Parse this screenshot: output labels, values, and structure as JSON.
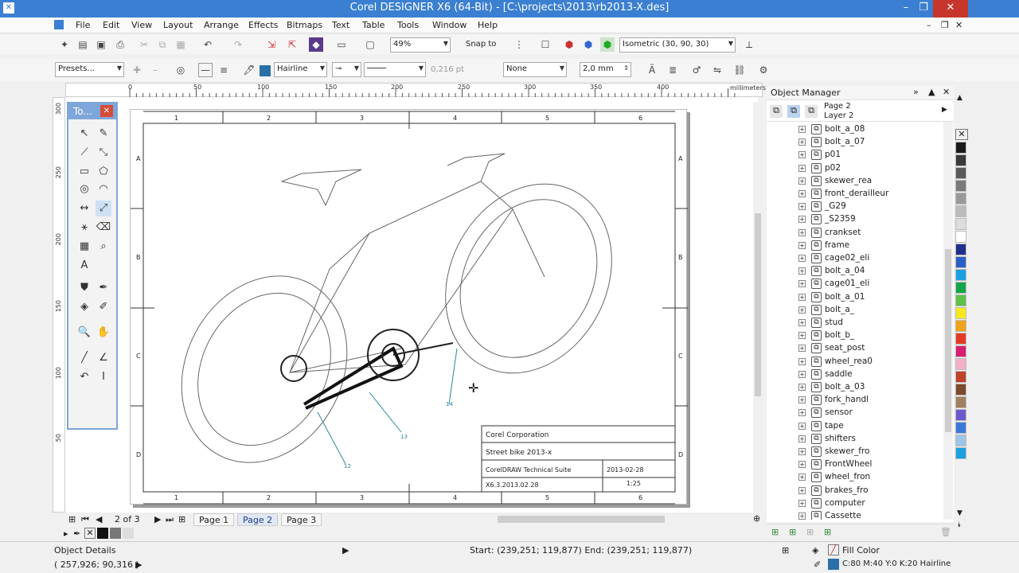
{
  "window": {
    "title": "Corel DESIGNER X6 (64-Bit) - [C:\\projects\\2013\\rb2013-X.des]"
  },
  "menu": [
    "File",
    "Edit",
    "View",
    "Layout",
    "Arrange",
    "Effects",
    "Bitmaps",
    "Text",
    "Table",
    "Tools",
    "Window",
    "Help"
  ],
  "standard_toolbar": {
    "zoom": "49%",
    "snap_to": "Snap to",
    "projection": "Isometric (30, 90, 30)"
  },
  "property_bar": {
    "presets": "Presets...",
    "outline_color_label": "Hairline",
    "offset": "0,216 pt",
    "arrow_end": "None",
    "size": "2,0 mm"
  },
  "ruler": {
    "units": "millimeters",
    "h_ticks": [
      "0",
      "50",
      "100",
      "150",
      "200",
      "250",
      "300",
      "350",
      "400"
    ],
    "v_ticks": [
      "300",
      "250",
      "200",
      "150",
      "100",
      "50"
    ]
  },
  "toolbox": {
    "title": "To..."
  },
  "drawing": {
    "col_labels": [
      "1",
      "2",
      "3",
      "4",
      "5",
      "6"
    ],
    "row_labels": [
      "A",
      "B",
      "C",
      "D"
    ],
    "callouts": [
      "14",
      "13",
      "12"
    ],
    "title_block": {
      "company": "Corel Corporation",
      "title": "Street bike 2013-x",
      "suite": "CorelDRAW Technical Suite",
      "date": "2013-02-28",
      "doc": "X6.3.2013.02.28",
      "scale": "1:25"
    }
  },
  "object_manager": {
    "title": "Object Manager",
    "page": "Page 2",
    "layer": "Layer 2",
    "items": [
      "bolt_a_08",
      "bolt_a_07",
      "p01",
      "p02",
      "skewer_rea",
      "front_derailleur",
      "_G29",
      "_S2359",
      "crankset",
      "frame",
      "cage02_eli",
      "bolt_a_04",
      "cage01_eli",
      "bolt_a_01",
      "bolt_a_",
      "stud",
      "bolt_b_",
      "seat_post",
      "wheel_rea0",
      "saddle",
      "bolt_a_03",
      "fork_handl",
      "sensor",
      "tape",
      "shifters",
      "skewer_fro",
      "FrontWheel",
      "wheel_fron",
      "brakes_fro",
      "computer",
      "Cassette"
    ]
  },
  "page_nav": {
    "counter": "2 of 3",
    "tabs": [
      "Page 1",
      "Page 2",
      "Page 3"
    ],
    "active": "Page 2"
  },
  "status": {
    "object_details": "Object Details",
    "coords": "( 257,926; 90,316 )",
    "start_end": "Start: (239,251; 119,877)  End: (239,251; 119,877)",
    "fill": "Fill Color",
    "outline": "C:80 M:40 Y:0 K:20  Hairline"
  },
  "colors": {
    "titlebar": "#3a7fd1",
    "accent": "#7ea6d8"
  },
  "palette": [
    "#1a1a1a",
    "#3a3a3a",
    "#5a5a5a",
    "#7a7a7a",
    "#9a9a9a",
    "#bcbcbc",
    "#dcdcdc",
    "#ffffff",
    "#1e2f8c",
    "#2960c7",
    "#1aa0e0",
    "#14a54b",
    "#5cc24a",
    "#f7e81c",
    "#f0a21a",
    "#e53a24",
    "#d81f6f",
    "#f4b0c8",
    "#c0432b",
    "#7b4a2c",
    "#a08060",
    "#6a5acd",
    "#3c78d8",
    "#9fc5e8",
    "#1aa0e0"
  ]
}
